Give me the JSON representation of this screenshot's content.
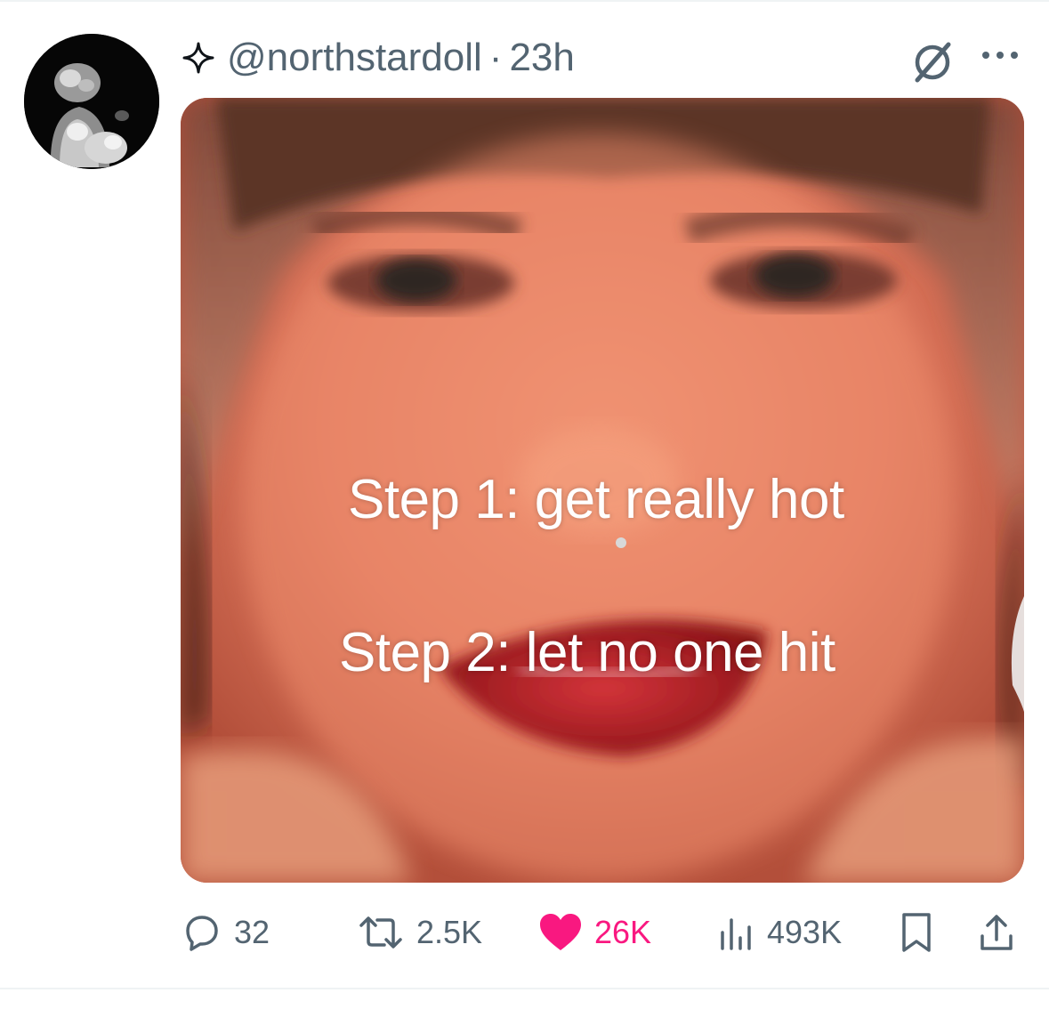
{
  "tweet": {
    "handle": "@northstardoll",
    "separator": "·",
    "time": "23h",
    "media": {
      "caption_line1": "Step 1: get really hot",
      "caption_line2": "Step 2: let no one hit"
    }
  },
  "actions": {
    "replies": "32",
    "reposts": "2.5K",
    "likes": "26K",
    "views": "493K"
  },
  "colors": {
    "like_active": "#f91880",
    "icon_gray": "#536471"
  },
  "icons": {
    "verified_type": "sparkle-icon",
    "grok": "grok-icon",
    "more": "more-icon",
    "reply": "reply-icon",
    "repost": "repost-icon",
    "like": "heart-icon",
    "views": "views-icon",
    "bookmark": "bookmark-icon",
    "share": "share-icon"
  }
}
